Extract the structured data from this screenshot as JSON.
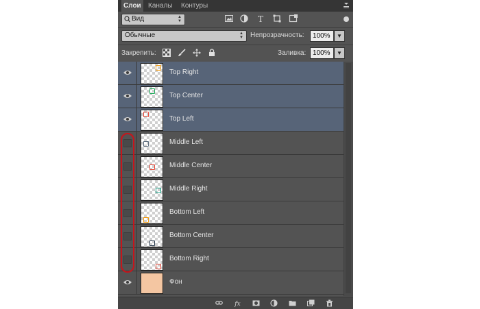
{
  "tabs": [
    {
      "label": "Слои",
      "active": true
    },
    {
      "label": "Каналы",
      "active": false
    },
    {
      "label": "Контуры",
      "active": false
    }
  ],
  "filter": {
    "kind": "Вид",
    "icons": [
      "image-filter-icon",
      "adjustment-filter-icon",
      "type-filter-icon",
      "shape-filter-icon",
      "smart-object-filter-icon"
    ]
  },
  "blend": {
    "mode": "Обычные",
    "opacity_label": "Непрозрачность:",
    "opacity": "100%"
  },
  "lock": {
    "label": "Закрепить:",
    "fill_label": "Заливка:",
    "fill": "100%"
  },
  "layers": [
    {
      "name": "Top Right",
      "visible": true,
      "selected": true,
      "mark_color": "#f39c12"
    },
    {
      "name": "Top Center",
      "visible": true,
      "selected": true,
      "mark_color": "#27ae60"
    },
    {
      "name": "Top Left",
      "visible": true,
      "selected": true,
      "mark_color": "#e74c3c"
    },
    {
      "name": "Middle Left",
      "visible": false,
      "selected": false,
      "mark_color": "#5d6d7e"
    },
    {
      "name": "Middle Center",
      "visible": false,
      "selected": false,
      "mark_color": "#e74c3c"
    },
    {
      "name": "Middle Right",
      "visible": false,
      "selected": false,
      "mark_color": "#16a085"
    },
    {
      "name": "Bottom Left",
      "visible": false,
      "selected": false,
      "mark_color": "#f39c12"
    },
    {
      "name": "Bottom Center",
      "visible": false,
      "selected": false,
      "mark_color": "#2c3e50"
    },
    {
      "name": "Bottom Right",
      "visible": false,
      "selected": false,
      "mark_color": "#e74c3c"
    },
    {
      "name": "Фон",
      "visible": true,
      "selected": false,
      "fill": "#f4c6a2"
    }
  ],
  "bottom_icons": [
    "link-layers-icon",
    "fx-icon",
    "add-mask-icon",
    "adjustment-layer-icon",
    "new-group-icon",
    "new-layer-icon",
    "delete-icon"
  ],
  "colors": {
    "panel": "#535353",
    "selected": "#576478",
    "annotation": "#c8141b"
  }
}
